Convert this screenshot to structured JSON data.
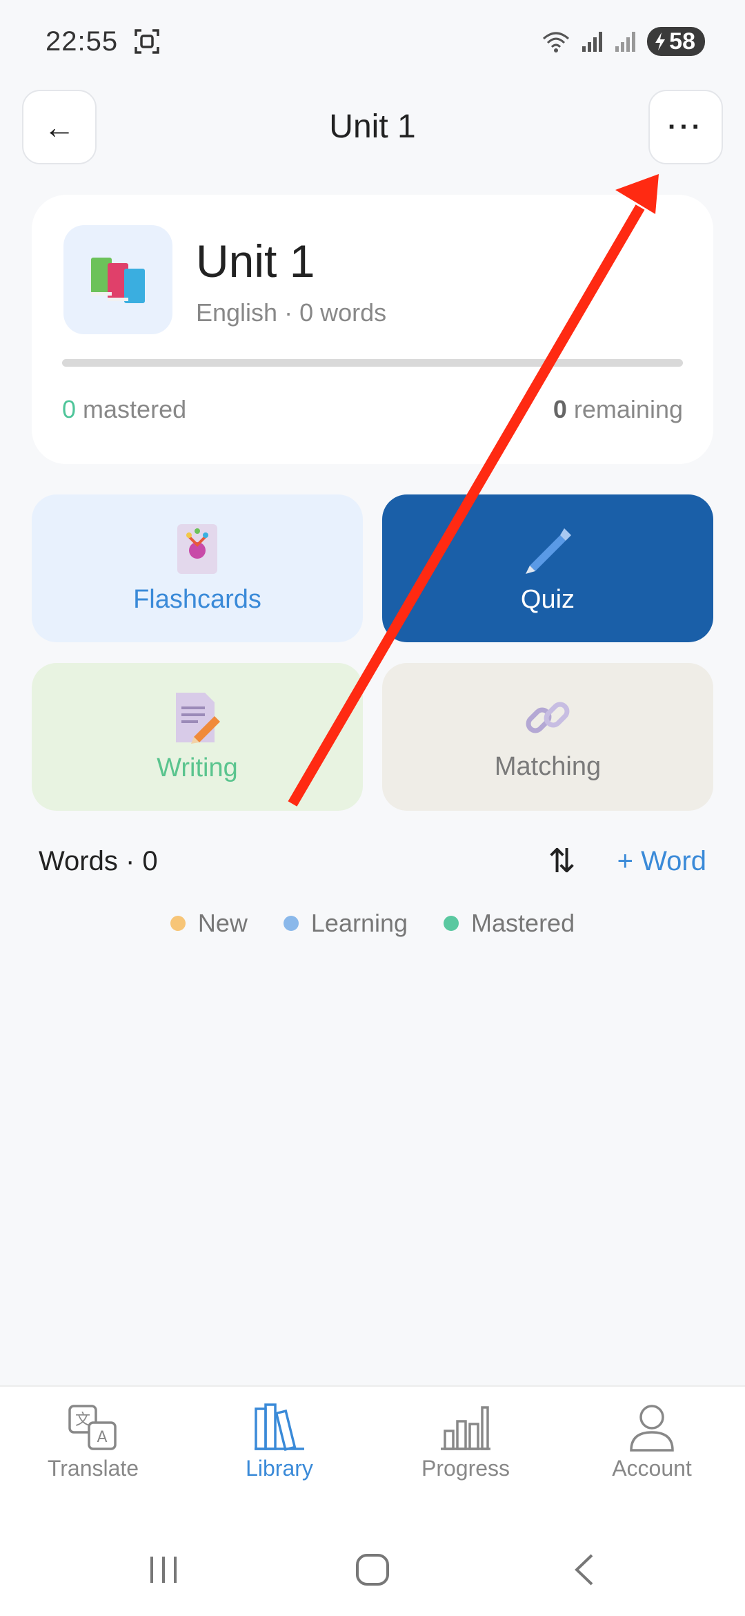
{
  "status_bar": {
    "time": "22:55",
    "battery": "58"
  },
  "header": {
    "back_icon": "←",
    "title": "Unit 1",
    "more_icon": "···"
  },
  "unit": {
    "name": "Unit 1",
    "subtitle": "English · 0 words",
    "mastered_count": "0",
    "mastered_label": "mastered",
    "remaining_count": "0",
    "remaining_label": "remaining",
    "progress_fraction": 0
  },
  "modes": {
    "flashcards": "Flashcards",
    "quiz": "Quiz",
    "writing": "Writing",
    "matching": "Matching"
  },
  "words": {
    "title": "Words · 0",
    "sort_icon": "⇅",
    "add_label": "+ Word"
  },
  "legend": [
    {
      "label": "New",
      "color": "#f7c577"
    },
    {
      "label": "Learning",
      "color": "#8ab8ea"
    },
    {
      "label": "Mastered",
      "color": "#5ac8a0"
    }
  ],
  "nav": {
    "translate": "Translate",
    "library": "Library",
    "progress": "Progress",
    "account": "Account"
  },
  "colors": {
    "accent": "#3a8ad8",
    "quiz_bg": "#1a5fa8",
    "annotation_arrow": "#ff2a12"
  }
}
